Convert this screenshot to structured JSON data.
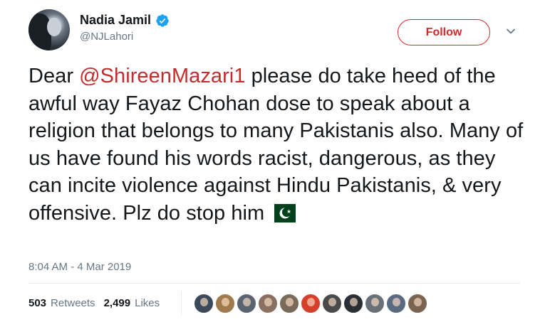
{
  "author": {
    "display_name": "Nadia Jamil",
    "handle": "@NJLahori",
    "verified": true
  },
  "follow_button": {
    "label": "Follow",
    "color": "#d72a2a"
  },
  "tweet": {
    "text_before": "Dear ",
    "mention": "@ShireenMazari1",
    "text_after": " please do take heed of the awful way Fayaz Chohan dose to speak about a religion that belongs to many Pakistanis also. Many of us have found his words racist, dangerous, as they can incite violence against Hindu Pakistanis, & very offensive. Plz do stop him",
    "emoji": "pakistan-flag-icon",
    "mention_color": "#c22d2d"
  },
  "timestamp": "8:04 AM - 4 Mar 2019",
  "stats": {
    "retweets_count": "503",
    "retweets_label": "Retweets",
    "likes_count": "2,499",
    "likes_label": "Likes"
  },
  "liker_avatars": [
    {
      "color": "#3a4a5a"
    },
    {
      "color": "#a07a4a"
    },
    {
      "color": "#5a6470"
    },
    {
      "color": "#8a7060"
    },
    {
      "color": "#7a6a5a"
    },
    {
      "color": "#d6402a"
    },
    {
      "color": "#4a4a4a"
    },
    {
      "color": "#2a2f35"
    },
    {
      "color": "#6a7078"
    },
    {
      "color": "#5a6a80"
    },
    {
      "color": "#7a6450"
    }
  ],
  "colors": {
    "text": "#14171a",
    "secondary": "#657786",
    "divider": "#e6ecf0",
    "verified": "#1da1f2",
    "flag_green": "#01411c"
  }
}
